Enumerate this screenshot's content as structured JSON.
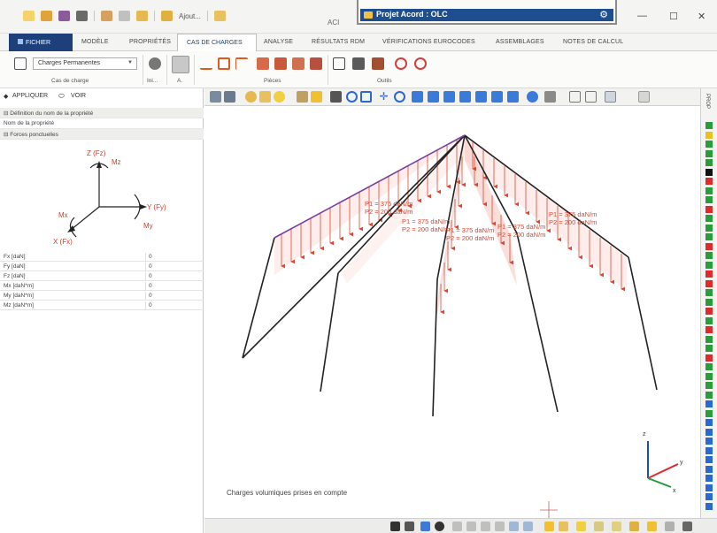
{
  "titlebar": {
    "app_short": "ACI",
    "quick_access_text": "Ajout...",
    "popup_title": "Projet Acord : OLC",
    "minimize": "—",
    "maximize": "☐",
    "close": "✕"
  },
  "tabs": {
    "file": "FICHIER",
    "items": [
      "MODÈLE",
      "PROPRIÉTÉS",
      "CAS DE CHARGES",
      "ANALYSE",
      "RÉSULTATS RDM",
      "VÉRIFICATIONS EUROCODES",
      "ASSEMBLAGES",
      "NOTES DE CALCUL"
    ],
    "active": "CAS DE CHARGES"
  },
  "ribbon": {
    "dropdown_value": "Charges Permanentes",
    "groups": [
      "Cas de charge",
      "Ini...",
      "A.",
      "Pièces",
      "Outils"
    ]
  },
  "left_panel": {
    "apply": "APPLIQUER",
    "view": "VOIR",
    "section_definition": "Définition du nom de la propriété",
    "property_name_label": "Nom de la propriété",
    "section_forces": "Forces ponctuelles",
    "axes": {
      "z": "Z (Fz)",
      "mz": "Mz",
      "y": "Y (Fy)",
      "my": "My",
      "mx": "Mx",
      "x": "X (Fx)"
    },
    "properties": [
      {
        "label": "Fx [daN]",
        "value": "0"
      },
      {
        "label": "Fy [daN]",
        "value": "0"
      },
      {
        "label": "Fz [daN]",
        "value": "0"
      },
      {
        "label": "Mx [daN*m]",
        "value": "0"
      },
      {
        "label": "My [daN*m]",
        "value": "0"
      },
      {
        "label": "Mz [daN*m]",
        "value": "0"
      }
    ]
  },
  "view": {
    "status_text": "Charges volumiques prises en compte",
    "load_labels": [
      "P1 = 375 daN/m",
      "P2 = 200 daN/m",
      "P1 = 375 daN/m",
      "P2 = 200 daN/m",
      "P1 = 375 daN/m",
      "P2 = 200 daN/m",
      "P1 = 375 daN/m",
      "P2 = 200 daN/m",
      "P1 = 375 daN/m",
      "P2 = 200 daN/m"
    ],
    "axis_x": "x",
    "axis_y": "y",
    "axis_z": "z"
  },
  "right_strip": {
    "label": "PROP"
  },
  "colors": {
    "accent": "#1d3f7a",
    "load_red": "#e0452f",
    "beam": "#222222",
    "ridge_purple": "#7a3fa0"
  },
  "palette": [
    "#2a9d3a",
    "#e8c020",
    "#2a9d3a",
    "#2a9d3a",
    "#2a9d3a",
    "#111111",
    "#e02a2a",
    "#2a9d3a",
    "#2a9d3a",
    "#e02a2a",
    "#2a9d3a",
    "#2a9d3a",
    "#2a9d3a",
    "#e02a2a",
    "#2a9d3a",
    "#2a9d3a",
    "#e02a2a",
    "#e02a2a",
    "#2a9d3a",
    "#2a9d3a",
    "#e02a2a",
    "#2a9d3a",
    "#e02a2a",
    "#2a9d3a",
    "#2a9d3a",
    "#e02a2a",
    "#2a9d3a",
    "#2a9d3a",
    "#2a9d3a",
    "#2a9d3a",
    "#2a6ad0",
    "#2a9d3a",
    "#2a6ad0",
    "#2a6ad0",
    "#2a6ad0",
    "#2a6ad0",
    "#2a6ad0",
    "#2a6ad0",
    "#2a6ad0",
    "#2a6ad0",
    "#2a6ad0",
    "#2a6ad0"
  ]
}
